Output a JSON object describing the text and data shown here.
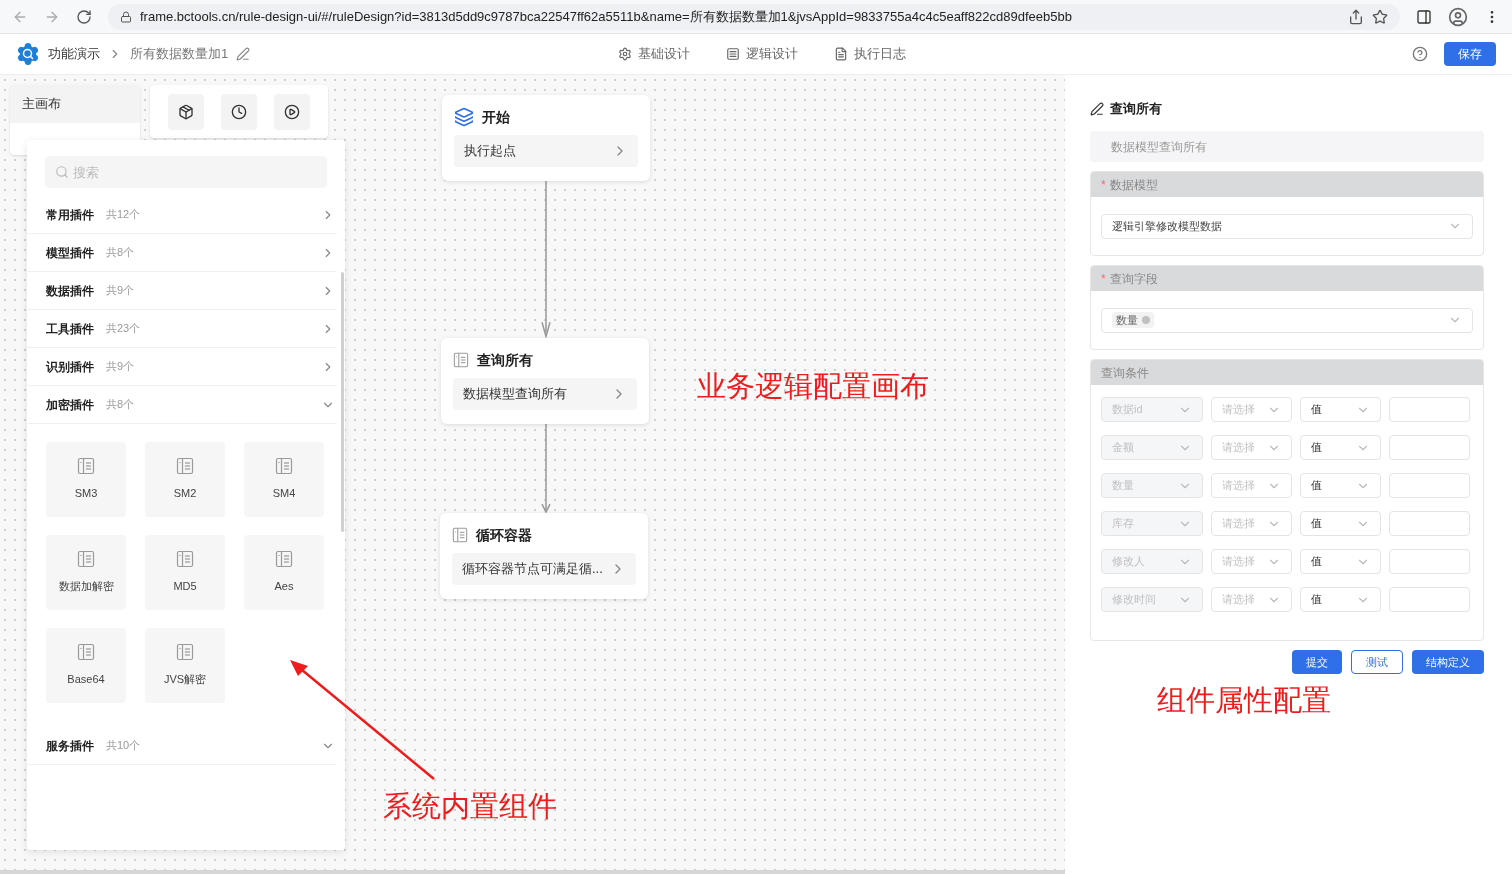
{
  "browser": {
    "url": "frame.bctools.cn/rule-design-ui/#/ruleDesign?id=3813d5dd9c9787bca22547ff62a5511b&name=所有数据数量加1&jvsAppId=9833755a4c4c5eaff822cd89dfeeb5bb"
  },
  "header": {
    "app_name": "功能演示",
    "breadcrumb": "所有数据数量加1",
    "tabs": [
      {
        "label": "基础设计",
        "kind": "settings"
      },
      {
        "label": "逻辑设计",
        "kind": "logic"
      },
      {
        "label": "执行日志",
        "kind": "log"
      }
    ],
    "save_button": "保存"
  },
  "canvas": {
    "canvas_tabs": [
      {
        "label": "主画布",
        "selected": true
      }
    ],
    "plugin_panel": {
      "search_placeholder": "搜索",
      "groups": [
        {
          "name": "常用插件",
          "count": "共12个",
          "expanded": false
        },
        {
          "name": "模型插件",
          "count": "共8个",
          "expanded": false
        },
        {
          "name": "数据插件",
          "count": "共9个",
          "expanded": false
        },
        {
          "name": "工具插件",
          "count": "共23个",
          "expanded": false
        },
        {
          "name": "识别插件",
          "count": "共9个",
          "expanded": false
        },
        {
          "name": "加密插件",
          "count": "共8个",
          "expanded": true,
          "items": [
            "SM3",
            "SM2",
            "SM4",
            "数据加解密",
            "MD5",
            "Aes",
            "Base64",
            "JVS解密"
          ]
        },
        {
          "name": "服务插件",
          "count": "共10个",
          "expanded": true
        }
      ]
    },
    "nodes": [
      {
        "kind": "start",
        "title": "开始",
        "description": "执行起点"
      },
      {
        "kind": "plugin",
        "title": "查询所有",
        "description": "数据模型查询所有"
      },
      {
        "kind": "plugin",
        "title": "循环容器",
        "description": "循环容器节点可满足循..."
      }
    ]
  },
  "properties": {
    "title": "查询所有",
    "name_value": "数据模型查询所有",
    "model_section": {
      "label": "数据模型",
      "required_mark": "*",
      "value": "逻辑引擎修改模型数据"
    },
    "fields_section": {
      "label": "查询字段",
      "required_mark": "*",
      "tags": [
        "数量"
      ]
    },
    "conditions_section": {
      "label": "查询条件",
      "rows": [
        {
          "field": "数据id",
          "operator_placeholder": "请选择",
          "value_type": "值"
        },
        {
          "field": "金额",
          "operator_placeholder": "请选择",
          "value_type": "值"
        },
        {
          "field": "数量",
          "operator_placeholder": "请选择",
          "value_type": "值"
        },
        {
          "field": "库存",
          "operator_placeholder": "请选择",
          "value_type": "值"
        },
        {
          "field": "修改人",
          "operator_placeholder": "请选择",
          "value_type": "值"
        },
        {
          "field": "修改时间",
          "operator_placeholder": "请选择",
          "value_type": "值"
        }
      ]
    },
    "buttons": [
      {
        "label": "提交",
        "kind": "primary"
      },
      {
        "label": "测试",
        "kind": "outline"
      },
      {
        "label": "结构定义",
        "kind": "primary"
      }
    ]
  },
  "annotations": [
    "业务逻辑配置画布",
    "组件属性配置",
    "系统内置组件"
  ]
}
